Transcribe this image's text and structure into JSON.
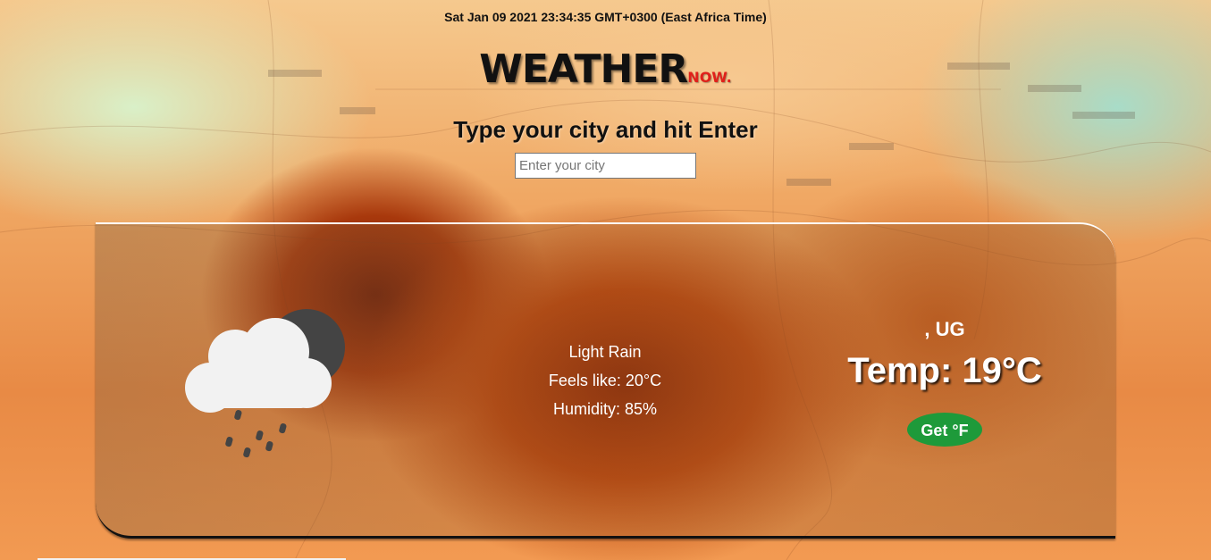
{
  "header": {
    "datetime": "Sat Jan 09 2021 23:34:35 GMT+0300 (East Africa Time)",
    "logo_main": "WEATHER",
    "logo_sub": "NOW."
  },
  "search": {
    "prompt": "Type your city and hit Enter",
    "placeholder": "Enter your city",
    "value": ""
  },
  "weather": {
    "icon": "cloud-moon-rain-icon",
    "description": "Light Rain",
    "feels_like": "Feels like: 20°C",
    "humidity": "Humidity: 85%",
    "location": ", UG",
    "temperature": "Temp: 19°C",
    "unit_button_label": "Get °F"
  },
  "colors": {
    "logo_accent": "#e0201a",
    "unit_button": "#1e9a3a",
    "moon": "#444444",
    "cloud": "#f2f2f2"
  }
}
